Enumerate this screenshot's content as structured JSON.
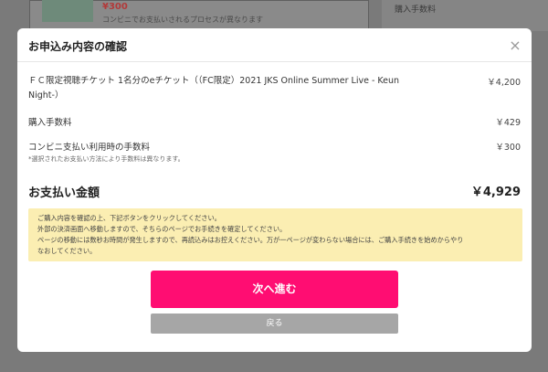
{
  "background": {
    "price": "¥300",
    "desc": "コンビニでお支払いされるプロセスが異なります",
    "side_label": "購入手数料"
  },
  "modal": {
    "title": "お申込み内容の確認",
    "close_symbol": "×",
    "items": [
      {
        "label": "ＦＣ限定視聴チケット 1名分のeチケット（（FC限定）2021 JKS Online Summer Live - Keun Night-）",
        "value": "￥4,200"
      },
      {
        "label": "購入手数料",
        "value": "￥429"
      },
      {
        "label": "コンビニ支払い利用時の手数料",
        "value": "￥300"
      }
    ],
    "note": "*選択されたお支払い方法により手数料は異なります。",
    "total": {
      "label": "お支払い金額",
      "value": "￥4,929"
    },
    "info_lines": [
      "ご購入内容を確認の上、下記ボタンをクリックしてください。",
      "外部の決済画面へ移動しますので、そちらのページでお手続きを確定してください。",
      "ページの移動には数秒お時間が発生しますので、再読込みはお控えください。万が一ページが変わらない場合には、ご購入手続きを始めからやり",
      "なおしてください。"
    ],
    "next_button": "次へ進む",
    "back_button": "戻る"
  },
  "colors": {
    "accent": "#ff0d72",
    "info_bg": "#fbeeb2"
  }
}
